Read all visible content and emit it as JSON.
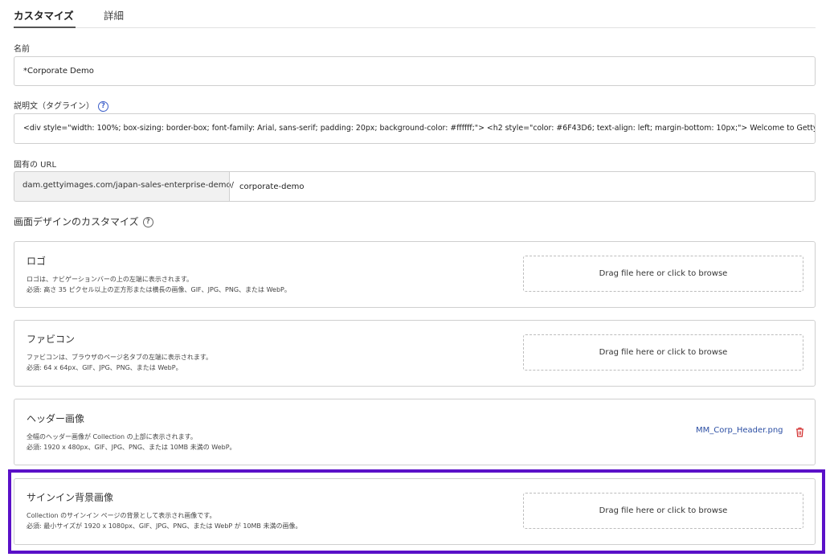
{
  "tabs": [
    {
      "label": "カスタマイズ",
      "active": true
    },
    {
      "label": "詳細",
      "active": false
    }
  ],
  "name": {
    "label": "名前",
    "value": "*Corporate Demo"
  },
  "description": {
    "label": "説明文（タグライン）",
    "value": "<div style=\"width: 100%; box-sizing: border-box; font-family: Arial, sans-serif; padding: 20px; background-color: #ffffff;\">  <h2 style=\"color: #6F43D6; text-align: left; margin-bottom: 10px;\">    Welcome to Getty Images"
  },
  "url": {
    "label": "固有の URL",
    "prefix": "dam.gettyimages.com/japan-sales-enterprise-demo/",
    "value": "corporate-demo"
  },
  "design": {
    "title": "画面デザインのカスタマイズ",
    "logo": {
      "title": "ロゴ",
      "desc1": "ロゴは、ナビゲーションバーの上の左端に表示されます。",
      "desc2": "必須: 高さ 35 ピクセル以上の正方形または横長の画像、GIF、JPG、PNG、または WebP。",
      "dropzone": "Drag file here or click to browse"
    },
    "favicon": {
      "title": "ファビコン",
      "desc1": "ファビコンは、ブラウザのページ名タブの左端に表示されます。",
      "desc2": "必須: 64 x 64px、GIF、JPG、PNG、または WebP。",
      "dropzone": "Drag file here or click to browse"
    },
    "header": {
      "title": "ヘッダー画像",
      "desc1": "全幅のヘッダー画像が Collection の上部に表示されます。",
      "desc2": "必須: 1920 x 480px、GIF、JPG、PNG、または 10MB 未満の WebP。",
      "file": "MM_Corp_Header.png"
    },
    "signin": {
      "title": "サインイン背景画像",
      "desc1": "Collection のサインイン ページの背景として表示され画像です。",
      "desc2": "必須: 最小サイズが 1920 x 1080px、GIF、JPG、PNG、または WebP が 10MB 未満の画像。",
      "dropzone": "Drag file here or click to browse"
    }
  },
  "colors": {
    "highlight": "#5a10c8",
    "link": "#2b4ea3",
    "delete": "#d22b2b",
    "help": "#3d5fc9"
  }
}
